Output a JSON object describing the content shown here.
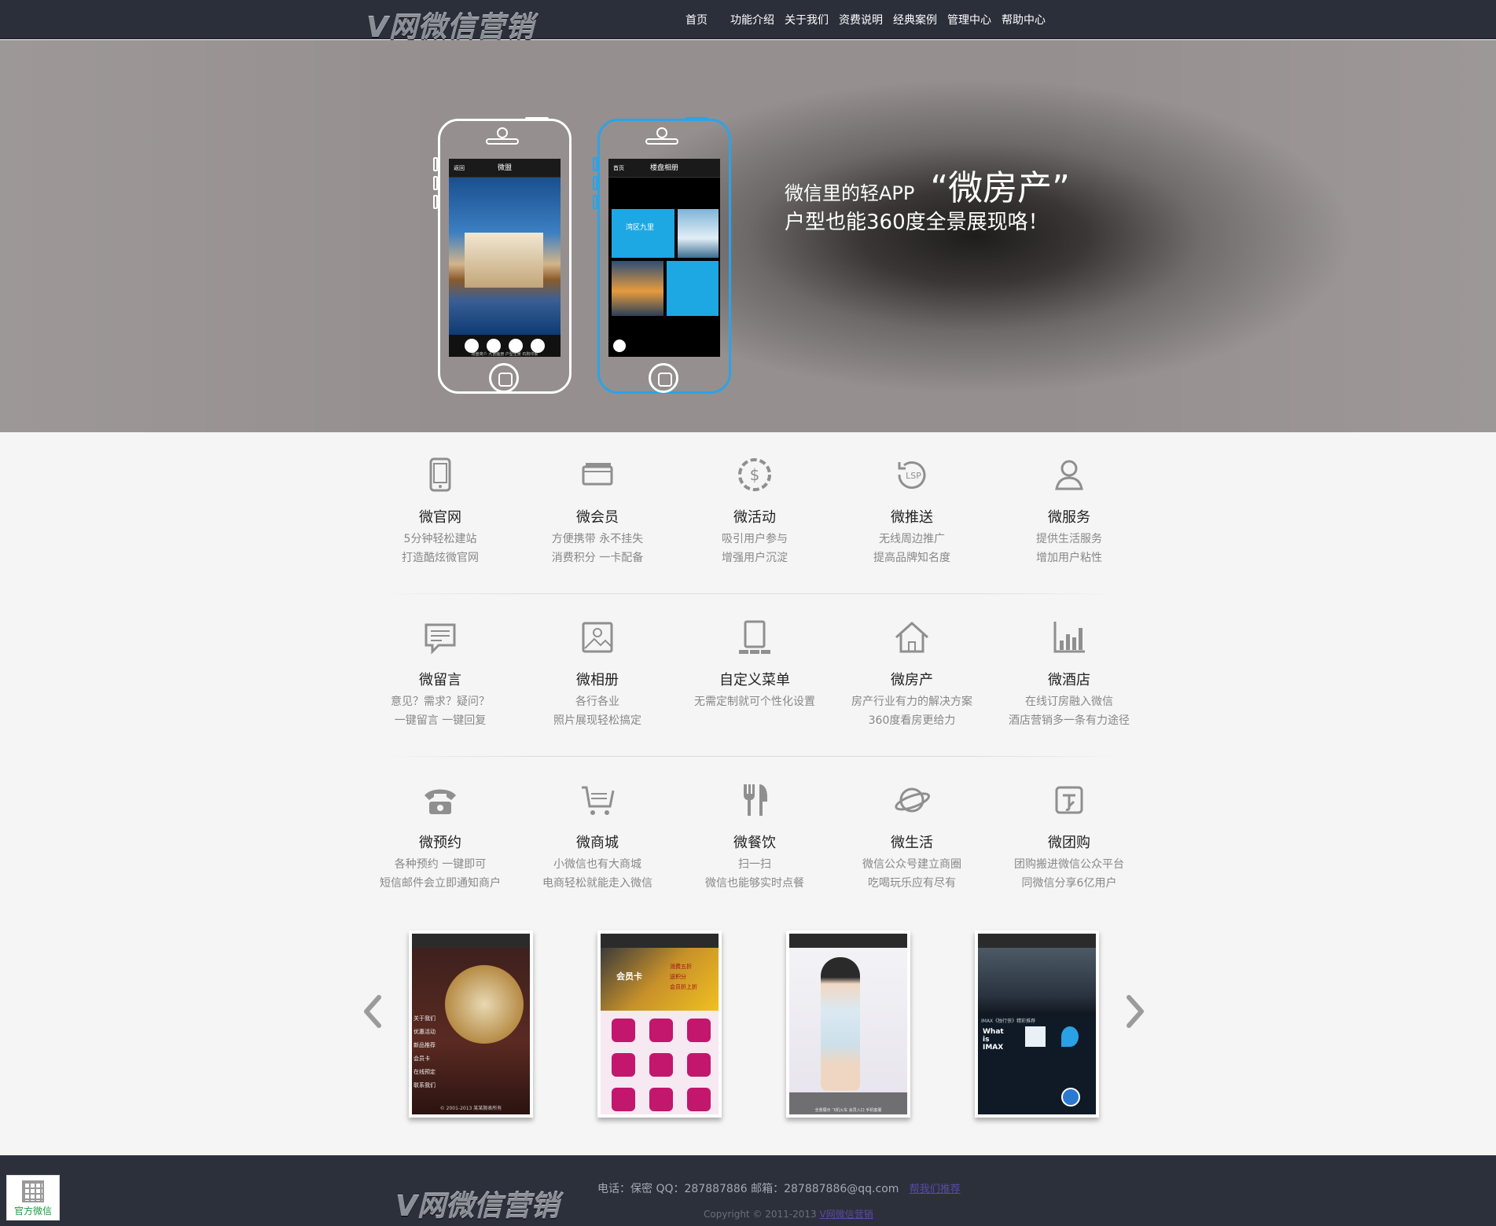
{
  "header": {
    "logo_text": "V网微信营销",
    "nav": [
      "首页",
      "功能介绍",
      "关于我们",
      "资费说明",
      "经典案例",
      "管理中心",
      "帮助中心"
    ]
  },
  "hero": {
    "title": "微信里的轻APP",
    "title_big": "“微房产”",
    "subtitle": "户型也能360度全景展现咯！",
    "phone1_header": "微盟",
    "phone1_back": "返回",
    "phone2_header": "楼盘相册",
    "phone2_back": "首页",
    "phone2_tile_title": "湾区九里",
    "phone1_tabs": "楼盘简介  九宫画册  户型全景  石狗印象"
  },
  "features": [
    {
      "icon": "tablet-icon",
      "title": "微官网",
      "line1": "5分钟轻松建站",
      "line2": "打造酷炫微官网"
    },
    {
      "icon": "cards-icon",
      "title": "微会员",
      "line1": "方便携带   永不挂失",
      "line2": "消费积分   一卡配备"
    },
    {
      "icon": "dollar-cycle-icon",
      "title": "微活动",
      "line1": "吸引用户参与",
      "line2": "增强用户沉淀"
    },
    {
      "icon": "lsp-icon",
      "title": "微推送",
      "line1": "无线周边推广",
      "line2": "提高品牌知名度"
    },
    {
      "icon": "user-service-icon",
      "title": "微服务",
      "line1": "提供生活服务",
      "line2": "增加用户粘性"
    },
    {
      "icon": "message-icon",
      "title": "微留言",
      "line1": "意见？需求？疑问？",
      "line2": "一键留言   一键回复"
    },
    {
      "icon": "picture-icon",
      "title": "微相册",
      "line1": "各行各业",
      "line2": "照片展现轻松搞定"
    },
    {
      "icon": "menu-device-icon",
      "title": "自定义菜单",
      "line1": "无需定制就可个性化设置",
      "line2": ""
    },
    {
      "icon": "house-icon",
      "title": "微房产",
      "line1": "房产行业有力的解决方案",
      "line2": "360度看房更给力"
    },
    {
      "icon": "chart-icon",
      "title": "微酒店",
      "line1": "在线订房融入微信",
      "line2": "酒店营销多一条有力途径"
    },
    {
      "icon": "telephone-icon",
      "title": "微预约",
      "line1": "各种预约 一键即可",
      "line2": "短信邮件会立即通知商户"
    },
    {
      "icon": "cart-icon",
      "title": "微商城",
      "line1": "小微信也有大商城",
      "line2": "电商轻松就能走入微信"
    },
    {
      "icon": "fork-knife-icon",
      "title": "微餐饮",
      "line1": "扫一扫",
      "line2": "微信也能够实时点餐"
    },
    {
      "icon": "planet-icon",
      "title": "微生活",
      "line1": "微信公众号建立商圈",
      "line2": "吃喝玩乐应有尽有"
    },
    {
      "icon": "group-buy-icon",
      "title": "微团购",
      "line1": "团购搬进微信公众平台",
      "line2": "同微信分享6亿用户"
    }
  ],
  "showcase": {
    "card1_menu": [
      "关于我们",
      "优惠活动",
      "新品推荐",
      "会员卡",
      "在线预定",
      "联系我们"
    ],
    "card1_footer": "© 2001-2013 某某腕表所有",
    "card2_stamp": "会员卡",
    "card2_lines": [
      "消费五折",
      "送积分",
      "会员折上折"
    ],
    "card3_nav": "全景展示  飞机火车  会员入口  手机客服",
    "card4_caption": "IMAX《独行侠》精彩推荐",
    "card4_label": "What is IMAX"
  },
  "footer": {
    "logo_text": "V网微信营销",
    "contact": "电话：保密    QQ：287887886    邮箱：287887886@qq.com",
    "contact_link": "帮我们推荐",
    "copyright": "Copyright © 2011-2013",
    "copyright_link": "V网微信营销"
  },
  "qr": {
    "label": "官方微信"
  },
  "colors": {
    "nav_bg": "#2a2f3a",
    "accent_blue": "#2ca3e6",
    "footer_bg": "#2b303b",
    "qr_label": "#1c9a43"
  }
}
